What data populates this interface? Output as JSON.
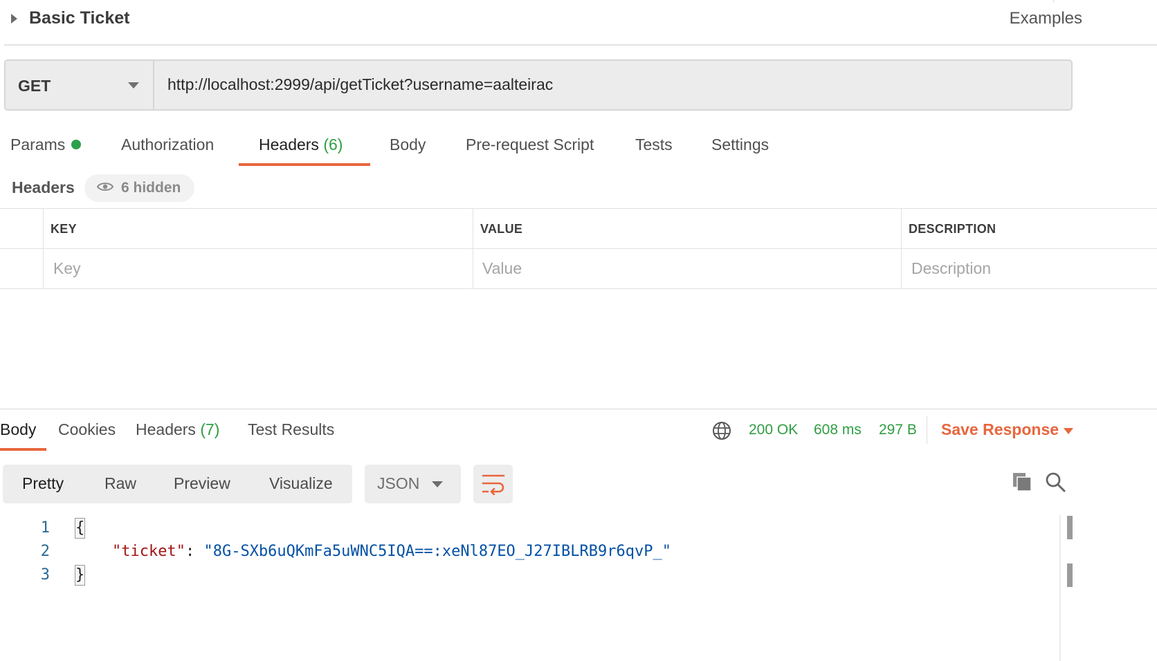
{
  "request": {
    "title": "Basic Ticket",
    "examples_label": "Examples",
    "method": "GET",
    "url": "http://localhost:2999/api/getTicket?username=aalteirac"
  },
  "request_tabs": [
    {
      "label": "Params",
      "count": ""
    },
    {
      "label": "Authorization",
      "count": ""
    },
    {
      "label": "Headers",
      "count": "(6)"
    },
    {
      "label": "Body",
      "count": ""
    },
    {
      "label": "Pre-request Script",
      "count": ""
    },
    {
      "label": "Tests",
      "count": ""
    },
    {
      "label": "Settings",
      "count": ""
    }
  ],
  "headers_section": {
    "label": "Headers",
    "hidden_label": "6 hidden",
    "columns": [
      "KEY",
      "VALUE",
      "DESCRIPTION"
    ],
    "placeholders": [
      "Key",
      "Value",
      "Description"
    ]
  },
  "response_tabs": [
    {
      "label": "Body",
      "count": ""
    },
    {
      "label": "Cookies",
      "count": ""
    },
    {
      "label": "Headers",
      "count": "(7)"
    },
    {
      "label": "Test Results",
      "count": ""
    }
  ],
  "response_status": {
    "status": "200 OK",
    "time": "608 ms",
    "size": "297 B",
    "save_label": "Save Response"
  },
  "view_modes": [
    "Pretty",
    "Raw",
    "Preview",
    "Visualize"
  ],
  "format": "JSON",
  "code": {
    "line_numbers": [
      "1",
      "2",
      "3"
    ],
    "open_brace": "{",
    "key": "\"ticket\"",
    "colon": ": ",
    "value": "\"8G-SXb6uQKmFa5uWNC5IQA==:xeNl87EO_J27IBLRB9r6qvP_\"",
    "close_brace": "}"
  },
  "colors": {
    "accent": "#e8663d",
    "success": "#2f9e44",
    "json_key": "#a31515",
    "json_string": "#0451a5"
  }
}
